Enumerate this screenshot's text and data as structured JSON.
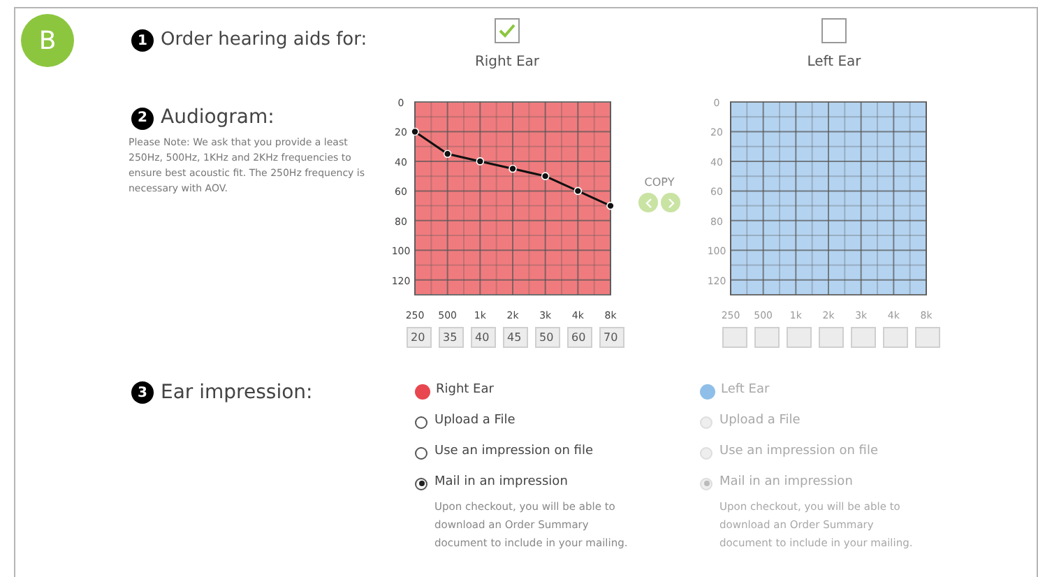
{
  "badge": "B",
  "order": {
    "number": "1",
    "title": "Order hearing aids for:",
    "ears": [
      {
        "label": "Right Ear",
        "checked": true
      },
      {
        "label": "Left Ear",
        "checked": false
      }
    ]
  },
  "audiogram": {
    "number": "2",
    "title": "Audiogram:",
    "note": "Please Note: We ask that you provide a least 250Hz, 500Hz, 1KHz and 2KHz frequencies to ensure best acoustic fit. The 250Hz frequency is necessary with AOV.",
    "copy_label": "COPY",
    "charts": [
      {
        "color": "#f07b7e",
        "readings": [
          "20",
          "35",
          "40",
          "45",
          "50",
          "60",
          "70"
        ],
        "chart_data": {
          "type": "line",
          "categories": [
            "250",
            "500",
            "1k",
            "2k",
            "3k",
            "4k",
            "8k"
          ],
          "series": [
            {
              "color": "#111111",
              "marker": "circle",
              "values": [
                20,
                35,
                40,
                45,
                50,
                60,
                70
              ]
            }
          ],
          "grid": true,
          "ylim": [
            130,
            0
          ],
          "yticks": [
            0,
            20,
            40,
            60,
            80,
            100,
            120
          ]
        }
      },
      {
        "color": "#b4d3f0",
        "chart_data": {
          "type": "line",
          "categories": [
            "250",
            "500",
            "1k",
            "2k",
            "3k",
            "4k",
            "8k"
          ],
          "series": [
            {
              "values": [
                null,
                null,
                null,
                null,
                null,
                null,
                null
              ]
            }
          ],
          "grid": true,
          "ylim": [
            130,
            0
          ],
          "yticks": [
            0,
            20,
            40,
            60,
            80,
            100,
            120
          ]
        }
      }
    ]
  },
  "impression": {
    "number": "3",
    "title": "Ear impression:",
    "ears": [
      {
        "label": "Right Ear",
        "color": "#e8474f",
        "disabled": false,
        "options": [
          {
            "label": "Upload a File",
            "selected": false
          },
          {
            "label": "Use an impression on file",
            "selected": false
          },
          {
            "label": "Mail in an impression",
            "selected": true
          }
        ],
        "note": "Upon checkout, you will be able to download an Order Summary document to include in your mailing."
      },
      {
        "label": "Left Ear",
        "color": "#8fbfe8",
        "disabled": true,
        "options": [
          {
            "label": "Upload a File",
            "selected": false
          },
          {
            "label": "Use an impression on file",
            "selected": false
          },
          {
            "label": "Mail in an impression",
            "selected": true
          }
        ],
        "note": "Upon checkout, you will be able to download an Order Summary document to include in your mailing."
      }
    ]
  }
}
